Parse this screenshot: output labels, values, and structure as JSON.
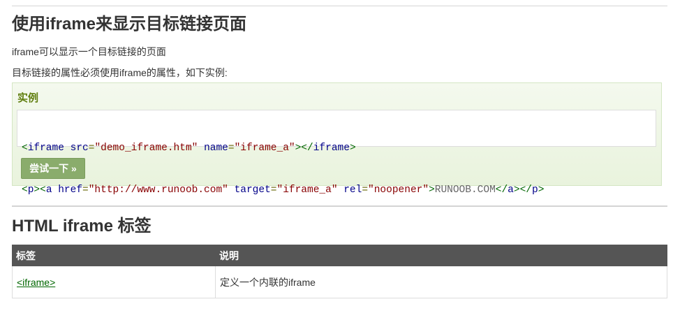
{
  "section1": {
    "heading": "使用iframe来显示目标链接页面",
    "para1": "iframe可以显示一个目标链接的页面",
    "para2": "目标链接的属性必须使用iframe的属性，如下实例:"
  },
  "example": {
    "title": "实例",
    "code": {
      "line1": {
        "open": "<",
        "tag": "iframe",
        "attr1": "src",
        "val1": "\"demo_iframe.htm\"",
        "attr2": "name",
        "val2": "\"iframe_a\"",
        "mid": "></",
        "tag_close": "iframe",
        "end": ">"
      },
      "line2": {
        "open_p": "<",
        "tag_p": "p",
        "close_p": "><",
        "tag_a": "a",
        "attr1": "href",
        "val1": "\"http://www.runoob.com\"",
        "attr2": "target",
        "val2": "\"iframe_a\"",
        "attr3": "rel",
        "val3": "\"noopener\"",
        "gt": ">",
        "text": "RUNOOB.COM",
        "lt_a": "</",
        "tag_a_close": "a",
        "mid": "></",
        "tag_p_close": "p",
        "end": ">"
      },
      "eq": "="
    },
    "try_button": "尝试一下 »"
  },
  "section2": {
    "heading": "HTML iframe 标签",
    "table": {
      "headers": [
        "标签",
        "说明"
      ],
      "rows": [
        {
          "tag": "<iframe>",
          "desc": "定义一个内联的iframe"
        }
      ]
    }
  }
}
